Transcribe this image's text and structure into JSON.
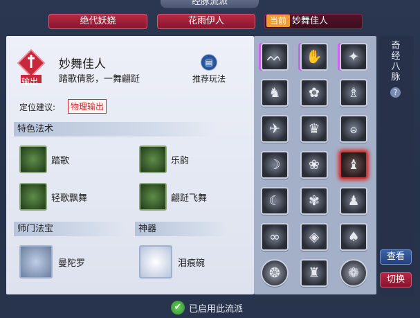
{
  "window": {
    "title": "经脉流派"
  },
  "tabs": [
    {
      "label": "绝代妖娆"
    },
    {
      "label": "花雨伊人"
    },
    {
      "label": "妙舞佳人",
      "prefix": "当前"
    }
  ],
  "hero": {
    "badge": "输出",
    "name": "妙舞佳人",
    "desc": "踏歌倩影，一舞翩跹"
  },
  "recommend": {
    "label": "推荐玩法"
  },
  "position": {
    "label": "定位建议:",
    "tag": "物理输出"
  },
  "sections": {
    "special": "特色法术",
    "treasure": "师门法宝",
    "artifact": "神器"
  },
  "skills": [
    {
      "label": "踏歌",
      "icon": "dance-step-icon"
    },
    {
      "label": "乐韵",
      "icon": "music-wave-icon"
    },
    {
      "label": "轻歌飘舞",
      "icon": "light-dance-icon"
    },
    {
      "label": "翩跹飞舞",
      "icon": "flying-dance-icon"
    }
  ],
  "treasure": {
    "label": "曼陀罗",
    "icon": "mandala-icon"
  },
  "artifact": {
    "label": "泪痕碗",
    "icon": "tear-bowl-icon"
  },
  "side": {
    "title": "奇经八脉",
    "help": "?",
    "view": "查看",
    "switch": "切换"
  },
  "status": {
    "label": "已启用此流派"
  },
  "meridian_icons": [
    "feather-wings-icon",
    "praying-hands-icon",
    "sparkles-icon",
    "dancer-icon",
    "lotus-icon",
    "juggler-icon",
    "crane-icon",
    "crown-icon",
    "spiral-figure-icon",
    "rabbit-icon",
    "petals-icon",
    "fan-dancer-icon",
    "crescent-icon",
    "flower-icon",
    "ribbon-dancer-icon",
    "knot-icon",
    "cube-icon",
    "swirl-dancer-icon",
    "round-emblem-icon",
    "tall-figure-icon",
    "shield-emblem-icon"
  ],
  "colors": {
    "accent_red": "#b62943",
    "current_orange": "#f19a2e",
    "check_green": "#4fb84a"
  }
}
